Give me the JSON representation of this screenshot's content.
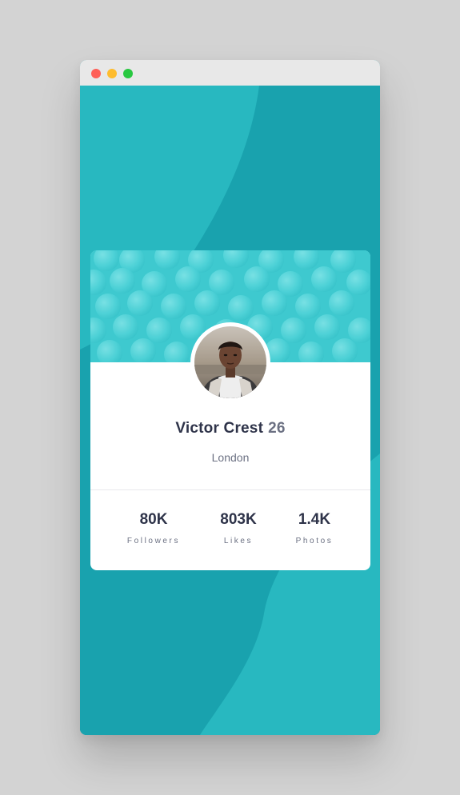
{
  "window": {
    "controls": [
      "close",
      "minimize",
      "maximize"
    ]
  },
  "colors": {
    "background": "#19a2ae",
    "accent_light": "#2bbcc3",
    "header": "#3ec9cf",
    "text_dark": "#2e3349",
    "text_gray": "#6b7082"
  },
  "profile": {
    "name": "Victor Crest",
    "age": "26",
    "city": "London",
    "avatar_icon": "avatar-photo"
  },
  "stats": [
    {
      "value": "80K",
      "label": "Followers"
    },
    {
      "value": "803K",
      "label": "Likes"
    },
    {
      "value": "1.4K",
      "label": "Photos"
    }
  ]
}
